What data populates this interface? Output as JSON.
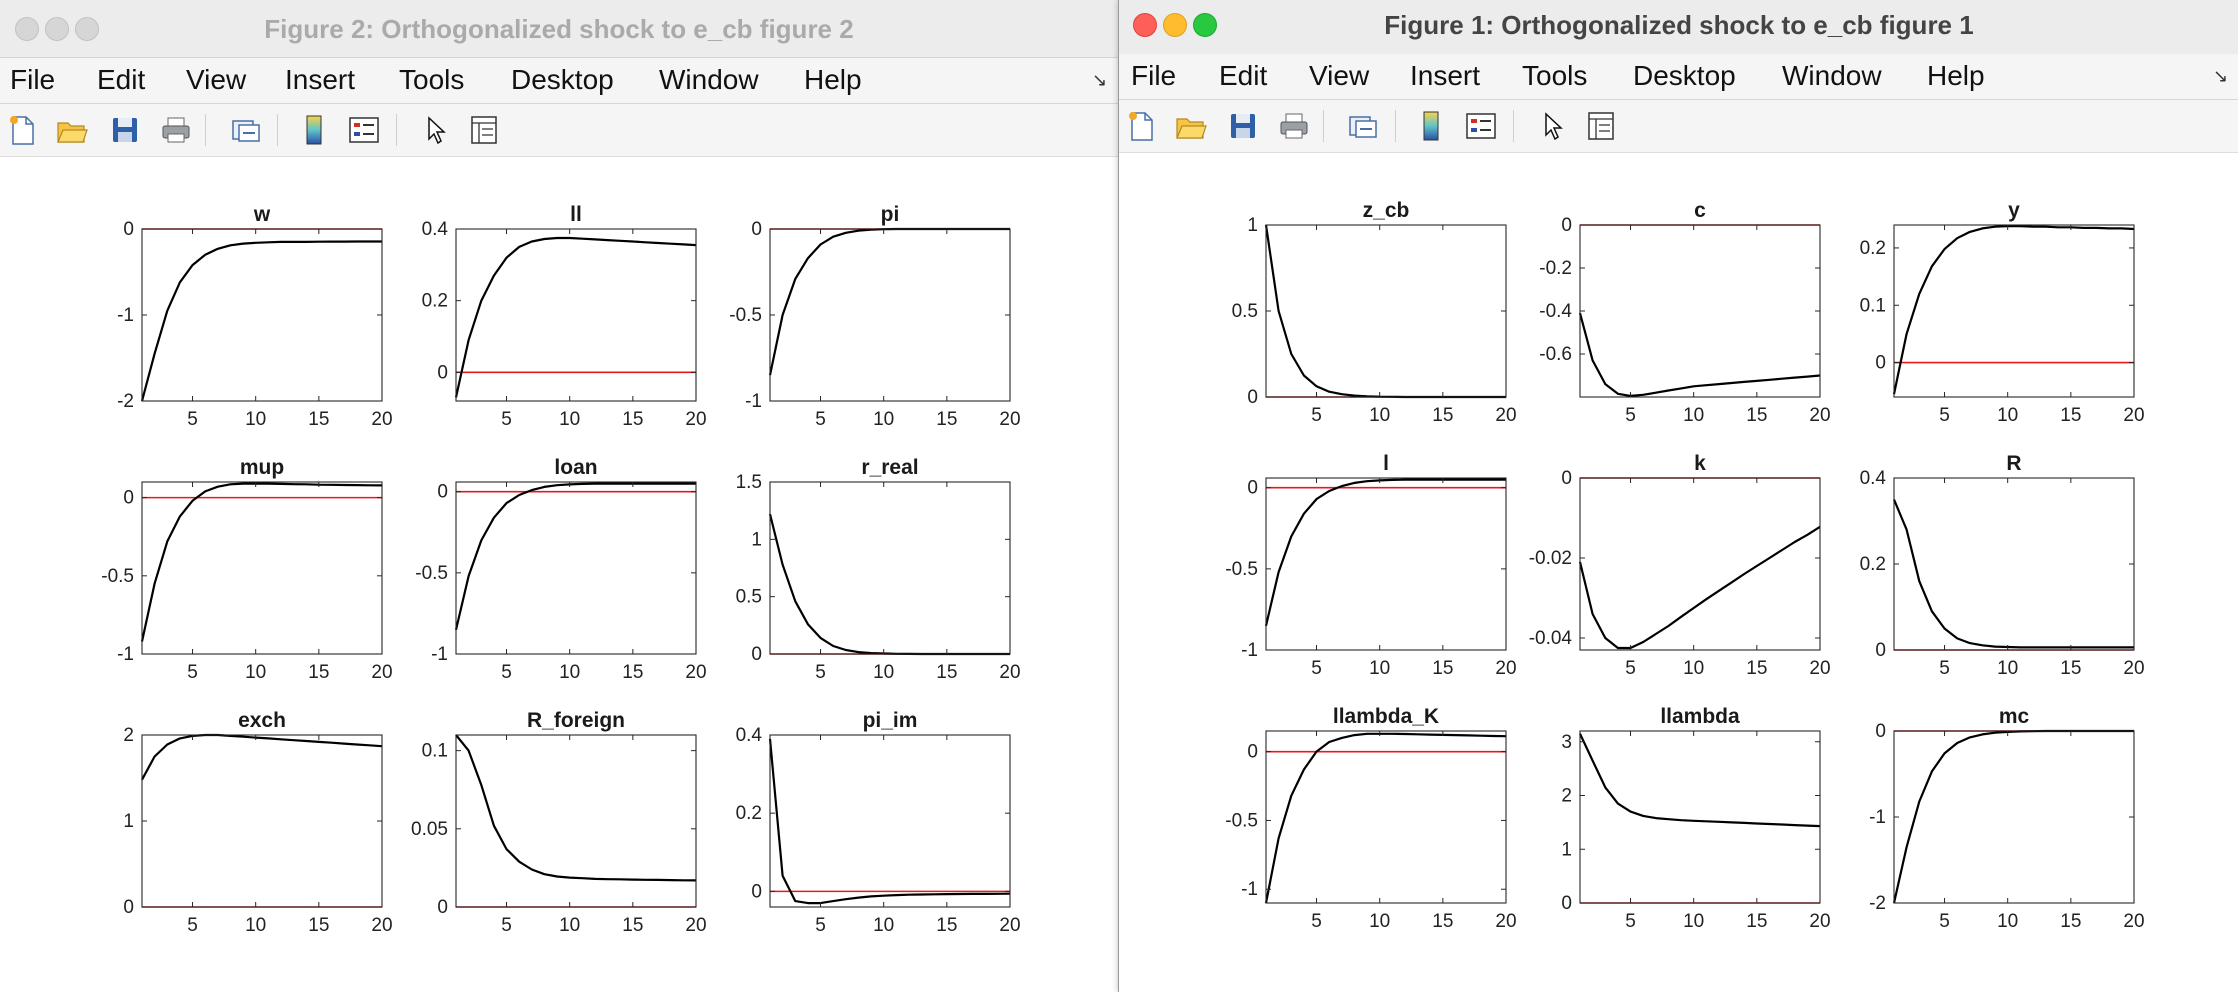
{
  "colors": {
    "irf_line": "#000000",
    "zero_line": "#e41a1c",
    "figure_background": "#ffffff"
  },
  "windows": [
    {
      "title": "Figure 2: Orthogonalized shock to e_cb figure 2",
      "state": "inactive",
      "menu": [
        "File",
        "Edit",
        "View",
        "Insert",
        "Tools",
        "Desktop",
        "Window",
        "Help"
      ],
      "toolbar_icons": [
        "new-figure-icon",
        "open-file-icon",
        "save-icon",
        "print-icon",
        "link-icon",
        "colorbar-icon",
        "legend-icon",
        "pointer-icon",
        "property-inspector-icon"
      ]
    },
    {
      "title": "Figure 1: Orthogonalized shock to e_cb figure 1",
      "state": "active",
      "menu": [
        "File",
        "Edit",
        "View",
        "Insert",
        "Tools",
        "Desktop",
        "Window",
        "Help"
      ],
      "toolbar_icons": [
        "new-figure-icon",
        "open-file-icon",
        "save-icon",
        "print-icon",
        "link-icon",
        "colorbar-icon",
        "legend-icon",
        "pointer-icon",
        "property-inspector-icon"
      ]
    }
  ],
  "chart_data": [
    {
      "type": "line",
      "window": 2,
      "title": "w",
      "xlim": [
        1,
        20
      ],
      "ylim": [
        -2,
        0
      ],
      "yticks": [
        0,
        -1,
        -2
      ],
      "ytick_labels": [
        "0",
        "-1",
        "-2"
      ],
      "xticks": [
        5,
        10,
        15,
        20
      ],
      "zero_line": 0,
      "x": [
        1,
        2,
        3,
        4,
        5,
        6,
        7,
        8,
        9,
        10,
        11,
        12,
        13,
        14,
        15,
        16,
        17,
        18,
        19,
        20
      ],
      "y": [
        -2.0,
        -1.45,
        -0.95,
        -0.62,
        -0.42,
        -0.3,
        -0.23,
        -0.19,
        -0.17,
        -0.16,
        -0.155,
        -0.15,
        -0.15,
        -0.15,
        -0.148,
        -0.147,
        -0.146,
        -0.145,
        -0.145,
        -0.145
      ]
    },
    {
      "type": "line",
      "window": 2,
      "title": "ll",
      "xlim": [
        1,
        20
      ],
      "ylim": [
        -0.08,
        0.4
      ],
      "yticks": [
        0.4,
        0.2,
        0
      ],
      "ytick_labels": [
        "0.4",
        "0.2",
        "0"
      ],
      "xticks": [
        5,
        10,
        15,
        20
      ],
      "zero_line": 0,
      "x": [
        1,
        2,
        3,
        4,
        5,
        6,
        7,
        8,
        9,
        10,
        11,
        12,
        13,
        14,
        15,
        16,
        17,
        18,
        19,
        20
      ],
      "y": [
        -0.07,
        0.09,
        0.2,
        0.27,
        0.32,
        0.35,
        0.365,
        0.372,
        0.375,
        0.375,
        0.373,
        0.371,
        0.369,
        0.367,
        0.365,
        0.363,
        0.361,
        0.359,
        0.357,
        0.355
      ]
    },
    {
      "type": "line",
      "window": 2,
      "title": "pi",
      "xlim": [
        1,
        20
      ],
      "ylim": [
        -1,
        0
      ],
      "yticks": [
        0,
        -0.5,
        -1
      ],
      "ytick_labels": [
        "0",
        "-0.5",
        "-1"
      ],
      "xticks": [
        5,
        10,
        15,
        20
      ],
      "zero_line": 0,
      "x": [
        1,
        2,
        3,
        4,
        5,
        6,
        7,
        8,
        9,
        10,
        11,
        12,
        13,
        14,
        15,
        16,
        17,
        18,
        19,
        20
      ],
      "y": [
        -0.85,
        -0.5,
        -0.29,
        -0.17,
        -0.09,
        -0.045,
        -0.022,
        -0.01,
        -0.004,
        -0.001,
        0.0,
        0.0,
        0.0,
        0.0,
        0.0,
        0.0,
        0.0,
        0.0,
        0.0,
        0.0
      ]
    },
    {
      "type": "line",
      "window": 2,
      "title": "mup",
      "xlim": [
        1,
        20
      ],
      "ylim": [
        -1,
        0.1
      ],
      "yticks": [
        0,
        -0.5,
        -1
      ],
      "ytick_labels": [
        "0",
        "-0.5",
        "-1"
      ],
      "xticks": [
        5,
        10,
        15,
        20
      ],
      "zero_line": 0,
      "x": [
        1,
        2,
        3,
        4,
        5,
        6,
        7,
        8,
        9,
        10,
        11,
        12,
        13,
        14,
        15,
        16,
        17,
        18,
        19,
        20
      ],
      "y": [
        -0.92,
        -0.55,
        -0.28,
        -0.12,
        -0.02,
        0.04,
        0.07,
        0.085,
        0.09,
        0.09,
        0.09,
        0.088,
        0.086,
        0.085,
        0.083,
        0.082,
        0.081,
        0.08,
        0.079,
        0.078
      ]
    },
    {
      "type": "line",
      "window": 2,
      "title": "loan",
      "xlim": [
        1,
        20
      ],
      "ylim": [
        -1,
        0.06
      ],
      "yticks": [
        0,
        -0.5,
        -1
      ],
      "ytick_labels": [
        "0",
        "-0.5",
        "-1"
      ],
      "xticks": [
        5,
        10,
        15,
        20
      ],
      "zero_line": 0,
      "x": [
        1,
        2,
        3,
        4,
        5,
        6,
        7,
        8,
        9,
        10,
        11,
        12,
        13,
        14,
        15,
        16,
        17,
        18,
        19,
        20
      ],
      "y": [
        -0.85,
        -0.52,
        -0.3,
        -0.16,
        -0.07,
        -0.02,
        0.01,
        0.03,
        0.04,
        0.045,
        0.048,
        0.05,
        0.05,
        0.05,
        0.05,
        0.05,
        0.05,
        0.05,
        0.05,
        0.05
      ]
    },
    {
      "type": "line",
      "window": 2,
      "title": "r_real",
      "xlim": [
        1,
        20
      ],
      "ylim": [
        0,
        1.5
      ],
      "yticks": [
        1.5,
        1,
        0.5,
        0
      ],
      "ytick_labels": [
        "1.5",
        "1",
        "0.5",
        "0"
      ],
      "xticks": [
        5,
        10,
        15,
        20
      ],
      "zero_line": 0,
      "x": [
        1,
        2,
        3,
        4,
        5,
        6,
        7,
        8,
        9,
        10,
        11,
        12,
        13,
        14,
        15,
        16,
        17,
        18,
        19,
        20
      ],
      "y": [
        1.22,
        0.78,
        0.46,
        0.26,
        0.14,
        0.07,
        0.035,
        0.017,
        0.008,
        0.004,
        0.002,
        0.001,
        0.0,
        0.0,
        0.0,
        0.0,
        0.0,
        0.0,
        0.0,
        0.0
      ]
    },
    {
      "type": "line",
      "window": 2,
      "title": "exch",
      "xlim": [
        1,
        20
      ],
      "ylim": [
        0,
        2
      ],
      "yticks": [
        2,
        1,
        0
      ],
      "ytick_labels": [
        "2",
        "1",
        "0"
      ],
      "xticks": [
        5,
        10,
        15,
        20
      ],
      "zero_line": 0,
      "x": [
        1,
        2,
        3,
        4,
        5,
        6,
        7,
        8,
        9,
        10,
        11,
        12,
        13,
        14,
        15,
        16,
        17,
        18,
        19,
        20
      ],
      "y": [
        1.48,
        1.75,
        1.89,
        1.96,
        1.99,
        2.0,
        2.0,
        1.99,
        1.98,
        1.97,
        1.96,
        1.95,
        1.94,
        1.93,
        1.92,
        1.91,
        1.9,
        1.89,
        1.88,
        1.87
      ]
    },
    {
      "type": "line",
      "window": 2,
      "title": "R_foreign",
      "xlim": [
        1,
        20
      ],
      "ylim": [
        0,
        0.11
      ],
      "yticks": [
        0.1,
        0.05,
        0
      ],
      "ytick_labels": [
        "0.1",
        "0.05",
        "0"
      ],
      "xticks": [
        5,
        10,
        15,
        20
      ],
      "zero_line": 0,
      "x": [
        1,
        2,
        3,
        4,
        5,
        6,
        7,
        8,
        9,
        10,
        11,
        12,
        13,
        14,
        15,
        16,
        17,
        18,
        19,
        20
      ],
      "y": [
        0.11,
        0.1,
        0.078,
        0.052,
        0.037,
        0.029,
        0.024,
        0.021,
        0.0195,
        0.0188,
        0.0184,
        0.018,
        0.0178,
        0.0177,
        0.0175,
        0.0174,
        0.0173,
        0.0172,
        0.0171,
        0.017
      ]
    },
    {
      "type": "line",
      "window": 2,
      "title": "pi_im",
      "xlim": [
        1,
        20
      ],
      "ylim": [
        -0.04,
        0.4
      ],
      "yticks": [
        0.4,
        0.2,
        0
      ],
      "ytick_labels": [
        "0.4",
        "0.2",
        "0"
      ],
      "xticks": [
        5,
        10,
        15,
        20
      ],
      "zero_line": 0,
      "x": [
        1,
        2,
        3,
        4,
        5,
        6,
        7,
        8,
        9,
        10,
        11,
        12,
        13,
        14,
        15,
        16,
        17,
        18,
        19,
        20
      ],
      "y": [
        0.39,
        0.04,
        -0.025,
        -0.03,
        -0.03,
        -0.025,
        -0.02,
        -0.016,
        -0.013,
        -0.011,
        -0.0095,
        -0.0085,
        -0.008,
        -0.0075,
        -0.007,
        -0.0068,
        -0.0066,
        -0.0064,
        -0.0062,
        -0.006
      ]
    },
    {
      "type": "line",
      "window": 1,
      "title": "z_cb",
      "xlim": [
        1,
        20
      ],
      "ylim": [
        0,
        1
      ],
      "yticks": [
        1,
        0.5,
        0
      ],
      "ytick_labels": [
        "1",
        "0.5",
        "0"
      ],
      "xticks": [
        5,
        10,
        15,
        20
      ],
      "zero_line": 0,
      "x": [
        1,
        2,
        3,
        4,
        5,
        6,
        7,
        8,
        9,
        10,
        11,
        12,
        13,
        14,
        15,
        16,
        17,
        18,
        19,
        20
      ],
      "y": [
        1.0,
        0.5,
        0.25,
        0.125,
        0.0625,
        0.031,
        0.016,
        0.008,
        0.004,
        0.002,
        0.001,
        0.0,
        0.0,
        0.0,
        0.0,
        0.0,
        0.0,
        0.0,
        0.0,
        0.0
      ]
    },
    {
      "type": "line",
      "window": 1,
      "title": "c",
      "xlim": [
        1,
        20
      ],
      "ylim": [
        -0.8,
        0
      ],
      "yticks": [
        0,
        -0.2,
        -0.4,
        -0.6
      ],
      "ytick_labels": [
        "0",
        "-0.2",
        "-0.4",
        "-0.6"
      ],
      "xticks": [
        5,
        10,
        15,
        20
      ],
      "zero_line": 0,
      "x": [
        1,
        2,
        3,
        4,
        5,
        6,
        7,
        8,
        9,
        10,
        11,
        12,
        13,
        14,
        15,
        16,
        17,
        18,
        19,
        20
      ],
      "y": [
        -0.41,
        -0.63,
        -0.74,
        -0.785,
        -0.795,
        -0.79,
        -0.78,
        -0.77,
        -0.76,
        -0.75,
        -0.745,
        -0.74,
        -0.735,
        -0.73,
        -0.725,
        -0.72,
        -0.715,
        -0.71,
        -0.705,
        -0.7
      ]
    },
    {
      "type": "line",
      "window": 1,
      "title": "y",
      "xlim": [
        1,
        20
      ],
      "ylim": [
        -0.06,
        0.24
      ],
      "yticks": [
        0.2,
        0.1,
        0
      ],
      "ytick_labels": [
        "0.2",
        "0.1",
        "0"
      ],
      "xticks": [
        5,
        10,
        15,
        20
      ],
      "zero_line": 0,
      "x": [
        1,
        2,
        3,
        4,
        5,
        6,
        7,
        8,
        9,
        10,
        11,
        12,
        13,
        14,
        15,
        16,
        17,
        18,
        19,
        20
      ],
      "y": [
        -0.055,
        0.05,
        0.12,
        0.168,
        0.198,
        0.217,
        0.228,
        0.234,
        0.237,
        0.238,
        0.238,
        0.237,
        0.237,
        0.236,
        0.236,
        0.235,
        0.235,
        0.234,
        0.234,
        0.233
      ]
    },
    {
      "type": "line",
      "window": 1,
      "title": "l",
      "xlim": [
        1,
        20
      ],
      "ylim": [
        -1,
        0.06
      ],
      "yticks": [
        0,
        -0.5,
        -1
      ],
      "ytick_labels": [
        "0",
        "-0.5",
        "-1"
      ],
      "xticks": [
        5,
        10,
        15,
        20
      ],
      "zero_line": 0,
      "x": [
        1,
        2,
        3,
        4,
        5,
        6,
        7,
        8,
        9,
        10,
        11,
        12,
        13,
        14,
        15,
        16,
        17,
        18,
        19,
        20
      ],
      "y": [
        -0.85,
        -0.52,
        -0.3,
        -0.16,
        -0.07,
        -0.02,
        0.01,
        0.03,
        0.04,
        0.045,
        0.048,
        0.05,
        0.05,
        0.05,
        0.05,
        0.05,
        0.05,
        0.05,
        0.05,
        0.05
      ]
    },
    {
      "type": "line",
      "window": 1,
      "title": "k",
      "xlim": [
        1,
        20
      ],
      "ylim": [
        -0.043,
        0
      ],
      "yticks": [
        0,
        -0.02,
        -0.04
      ],
      "ytick_labels": [
        "0",
        "-0.02",
        "-0.04"
      ],
      "xticks": [
        5,
        10,
        15,
        20
      ],
      "zero_line": 0,
      "x": [
        1,
        2,
        3,
        4,
        5,
        6,
        7,
        8,
        9,
        10,
        11,
        12,
        13,
        14,
        15,
        16,
        17,
        18,
        19,
        20
      ],
      "y": [
        -0.021,
        -0.034,
        -0.04,
        -0.0425,
        -0.0425,
        -0.041,
        -0.039,
        -0.037,
        -0.0347,
        -0.0325,
        -0.0303,
        -0.0282,
        -0.0261,
        -0.024,
        -0.022,
        -0.02,
        -0.018,
        -0.016,
        -0.0142,
        -0.0122
      ]
    },
    {
      "type": "line",
      "window": 1,
      "title": "R",
      "xlim": [
        1,
        20
      ],
      "ylim": [
        0,
        0.4
      ],
      "yticks": [
        0.4,
        0.2,
        0
      ],
      "ytick_labels": [
        "0.4",
        "0.2",
        "0"
      ],
      "xticks": [
        5,
        10,
        15,
        20
      ],
      "zero_line": 0,
      "x": [
        1,
        2,
        3,
        4,
        5,
        6,
        7,
        8,
        9,
        10,
        11,
        12,
        13,
        14,
        15,
        16,
        17,
        18,
        19,
        20
      ],
      "y": [
        0.35,
        0.28,
        0.16,
        0.09,
        0.05,
        0.027,
        0.016,
        0.011,
        0.008,
        0.007,
        0.006,
        0.006,
        0.006,
        0.006,
        0.006,
        0.006,
        0.006,
        0.006,
        0.006,
        0.006
      ]
    },
    {
      "type": "line",
      "window": 1,
      "title": "llambda_K",
      "xlim": [
        1,
        20
      ],
      "ylim": [
        -1.1,
        0.15
      ],
      "yticks": [
        0,
        -0.5,
        -1
      ],
      "ytick_labels": [
        "0",
        "-0.5",
        "-1"
      ],
      "xticks": [
        5,
        10,
        15,
        20
      ],
      "zero_line": 0,
      "x": [
        1,
        2,
        3,
        4,
        5,
        6,
        7,
        8,
        9,
        10,
        11,
        12,
        13,
        14,
        15,
        16,
        17,
        18,
        19,
        20
      ],
      "y": [
        -1.1,
        -0.63,
        -0.32,
        -0.13,
        0.0,
        0.07,
        0.1,
        0.12,
        0.13,
        0.13,
        0.13,
        0.128,
        0.126,
        0.124,
        0.122,
        0.12,
        0.118,
        0.116,
        0.114,
        0.112
      ]
    },
    {
      "type": "line",
      "window": 1,
      "title": "llambda",
      "xlim": [
        1,
        20
      ],
      "ylim": [
        0,
        3.2
      ],
      "yticks": [
        3,
        2,
        1,
        0
      ],
      "ytick_labels": [
        "3",
        "2",
        "1",
        "0"
      ],
      "xticks": [
        5,
        10,
        15,
        20
      ],
      "zero_line": 0,
      "x": [
        1,
        2,
        3,
        4,
        5,
        6,
        7,
        8,
        9,
        10,
        11,
        12,
        13,
        14,
        15,
        16,
        17,
        18,
        19,
        20
      ],
      "y": [
        3.15,
        2.65,
        2.15,
        1.85,
        1.7,
        1.62,
        1.58,
        1.56,
        1.54,
        1.53,
        1.52,
        1.51,
        1.5,
        1.49,
        1.48,
        1.47,
        1.46,
        1.45,
        1.44,
        1.43
      ]
    },
    {
      "type": "line",
      "window": 1,
      "title": "mc",
      "xlim": [
        1,
        20
      ],
      "ylim": [
        -2,
        0
      ],
      "yticks": [
        0,
        -1,
        -2
      ],
      "ytick_labels": [
        "0",
        "-1",
        "-2"
      ],
      "xticks": [
        5,
        10,
        15,
        20
      ],
      "zero_line": 0,
      "x": [
        1,
        2,
        3,
        4,
        5,
        6,
        7,
        8,
        9,
        10,
        11,
        12,
        13,
        14,
        15,
        16,
        17,
        18,
        19,
        20
      ],
      "y": [
        -2.0,
        -1.35,
        -0.82,
        -0.47,
        -0.26,
        -0.14,
        -0.075,
        -0.04,
        -0.02,
        -0.01,
        -0.005,
        -0.002,
        0.0,
        0.0,
        0.0,
        0.0,
        0.0,
        0.0,
        0.0,
        0.0
      ]
    }
  ]
}
